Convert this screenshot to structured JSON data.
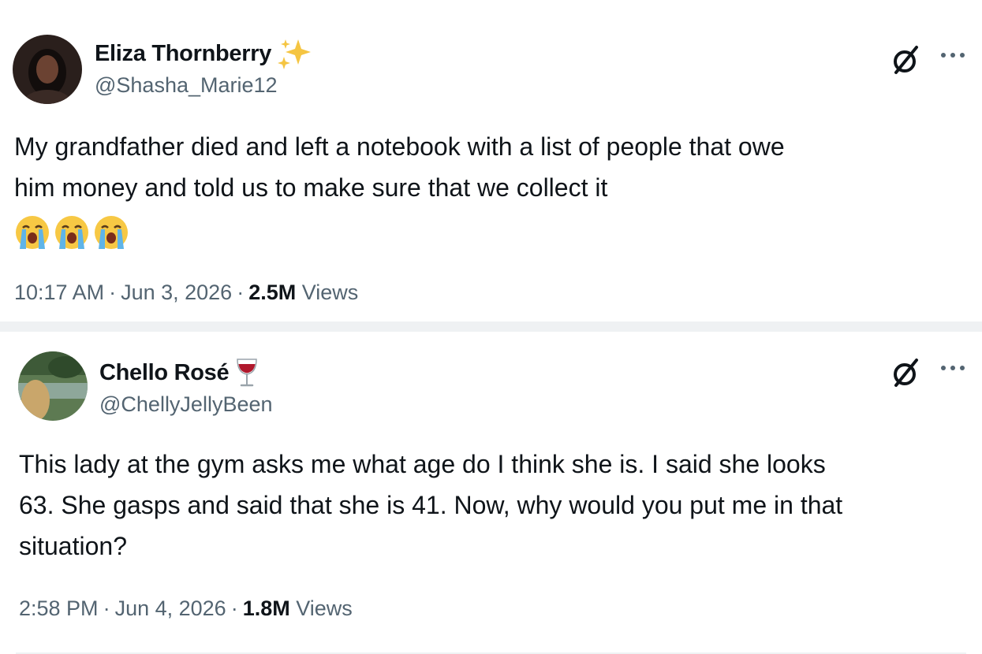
{
  "tweets": [
    {
      "display_name": "Eliza Thornberry",
      "name_emoji": "sparkles-icon",
      "handle": "@Shasha_Marie12",
      "text": "My grandfather died and left a notebook with a list of people that owe\nhim money and told us to make sure that we collect it",
      "emojis": [
        "loudly-crying-face-icon",
        "loudly-crying-face-icon",
        "loudly-crying-face-icon"
      ],
      "time": "10:17 AM",
      "date": "Jun 3, 2026",
      "views_count": "2.5M",
      "views_label": "Views"
    },
    {
      "display_name": "Chello Rosé",
      "name_emoji": "wine-glass-icon",
      "handle": "@ChellyJellyBeen",
      "text": "This lady at the gym asks me what age do I think she is. I said she looks\n63. She gasps and said that she is 41. Now, why would you put me in that\nsituation?",
      "time": "2:58 PM",
      "date": "Jun 4, 2026",
      "views_count": "1.8M",
      "views_label": "Views"
    }
  ],
  "separator": "·",
  "colors": {
    "text": "#0f1419",
    "secondary": "#536471",
    "divider": "#eff1f3",
    "sparkle": "#f5c542"
  }
}
